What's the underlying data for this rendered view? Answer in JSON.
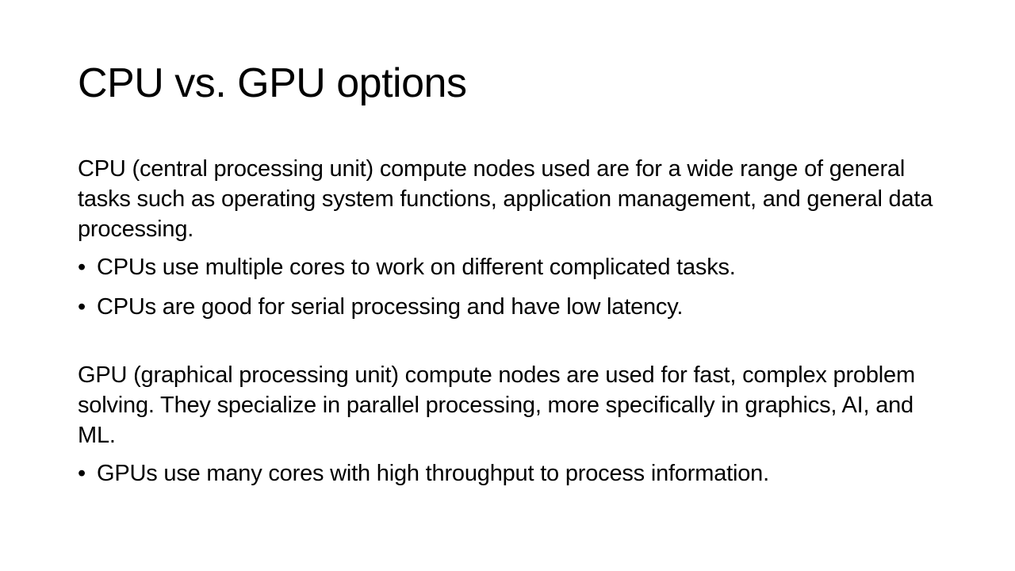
{
  "slide": {
    "title": "CPU vs. GPU options",
    "sections": [
      {
        "paragraph": "CPU (central processing unit) compute nodes used are for a wide range of general tasks such as operating system functions, application management, and general data processing.",
        "bullets": [
          "CPUs use multiple cores to work on different complicated tasks.",
          "CPUs are good for serial processing and have low latency."
        ]
      },
      {
        "paragraph": "GPU (graphical processing unit) compute nodes are used for fast, complex problem solving. They specialize in parallel processing, more specifically in graphics, AI, and ML.",
        "bullets": [
          "GPUs use many cores with high throughput to process information."
        ]
      }
    ],
    "bullet_glyph": "•"
  }
}
